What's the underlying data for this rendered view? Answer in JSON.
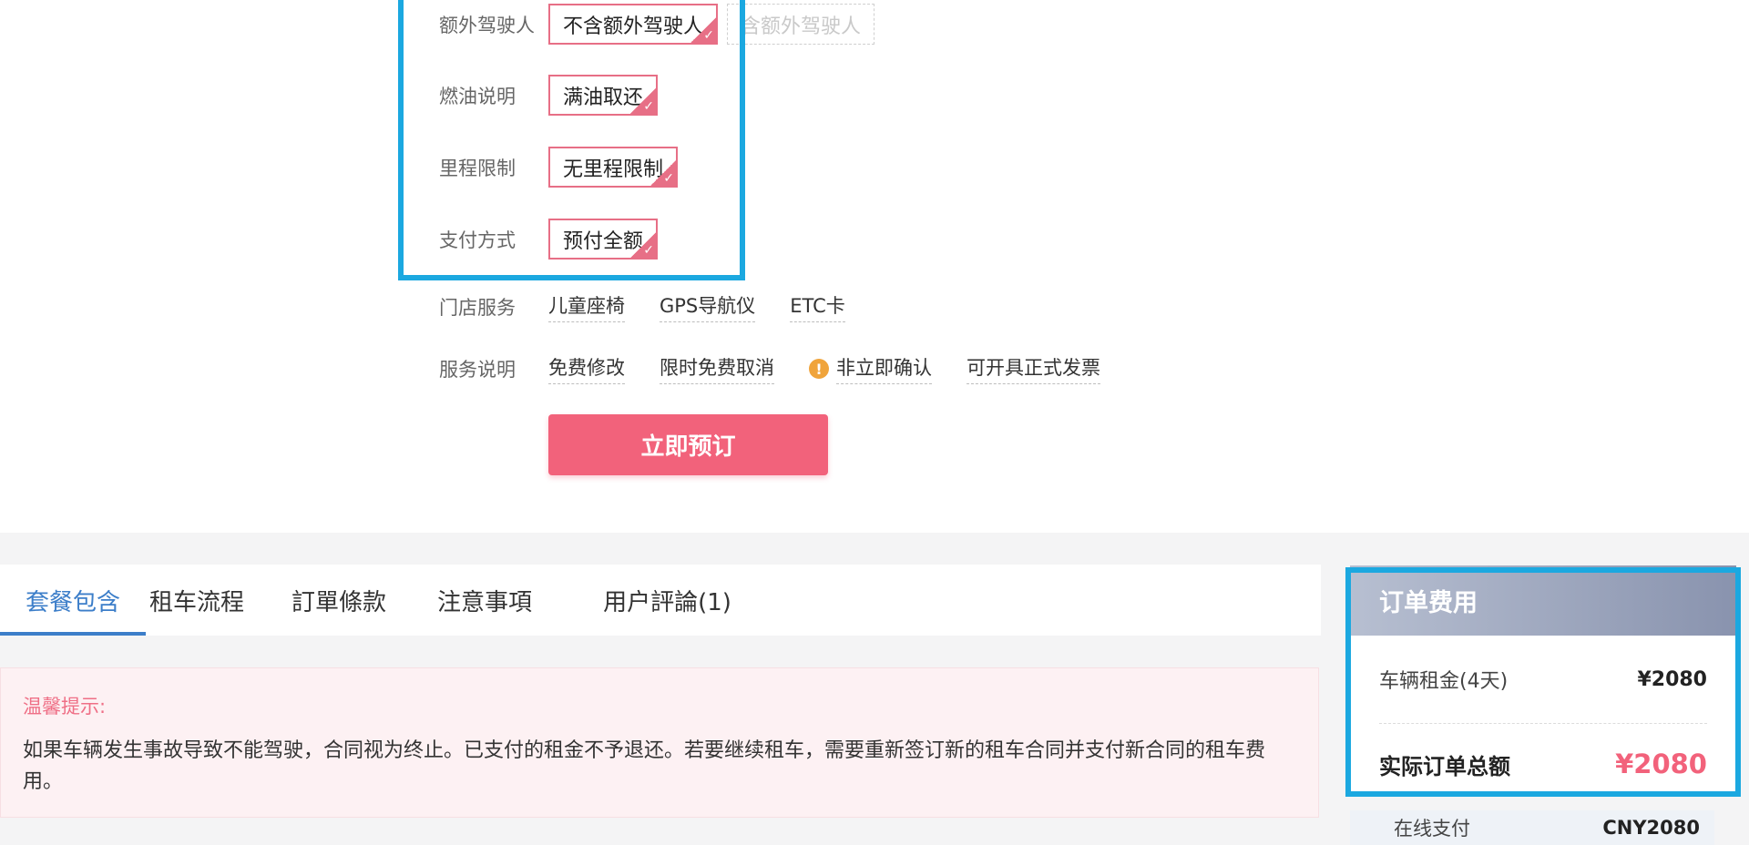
{
  "options": [
    {
      "label": "额外驾驶人",
      "chips": [
        {
          "text": "不含额外驾驶人",
          "selected": true
        },
        {
          "text": "含额外驾驶人",
          "selected": false
        }
      ]
    },
    {
      "label": "燃油说明",
      "chips": [
        {
          "text": "满油取还",
          "selected": true
        }
      ]
    },
    {
      "label": "里程限制",
      "chips": [
        {
          "text": "无里程限制",
          "selected": true
        }
      ]
    },
    {
      "label": "支付方式",
      "chips": [
        {
          "text": "预付全额",
          "selected": true
        }
      ]
    }
  ],
  "store_services": {
    "label": "门店服务",
    "items": [
      "儿童座椅",
      "GPS导航仪",
      "ETC卡"
    ]
  },
  "service_notes": {
    "label": "服务说明",
    "items": [
      "免费修改",
      "限时免费取消",
      "非立即确认",
      "可开具正式发票"
    ],
    "warn_icon": "!"
  },
  "book_button": "立即预订",
  "tabs": [
    "套餐包含",
    "租车流程",
    "訂單條款",
    "注意事項",
    "用户評論(1)"
  ],
  "notice": {
    "title": "温馨提示:",
    "text": "如果车辆发生事故导致不能驾驶，合同视为终止。已支付的租金不予退还。若要继续租车，需要重新签订新的租车合同并支付新合同的租车费用。"
  },
  "fees": {
    "title": "订单费用",
    "rent_label": "车辆租金(4天)",
    "rent_amount": "¥2080",
    "total_label": "实际订单总额",
    "total_amount": "¥2080",
    "pay_label": "在线支付",
    "pay_amount": "CNY2080"
  },
  "colors": {
    "accent": "#f2627b",
    "highlight": "#1ba8e0",
    "tab_active": "#3c7ec9"
  }
}
